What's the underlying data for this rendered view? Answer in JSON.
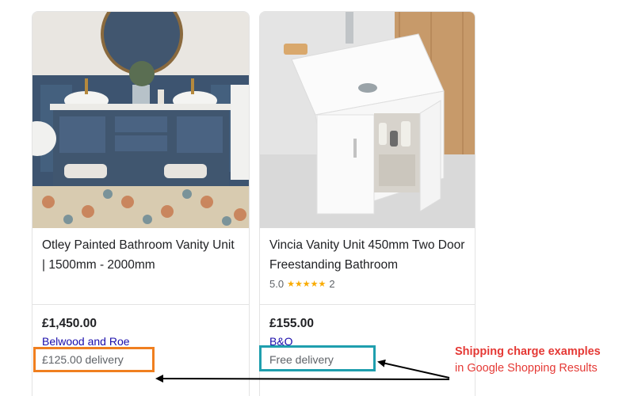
{
  "products": [
    {
      "title": "Otley Painted Bathroom Vanity Unit | 1500mm - 2000mm",
      "price": "£1,450.00",
      "merchant": "Belwood and Roe",
      "delivery": "£125.00 delivery"
    },
    {
      "title": "Vincia Vanity Unit 450mm Two Door Freestanding Bathroom",
      "rating": "5.0",
      "rating_stars": "★★★★★",
      "rating_count": "2",
      "price": "£155.00",
      "merchant": "B&Q",
      "delivery": "Free delivery"
    }
  ],
  "annotation": {
    "line1": "Shipping charge examples",
    "line2": "in Google Shopping Results"
  },
  "colors": {
    "highlight_paid": "#f07f1f",
    "highlight_free": "#1f9fae",
    "annotation": "#e53935",
    "merchant_link": "#1a0dab",
    "star": "#f9ab00"
  }
}
